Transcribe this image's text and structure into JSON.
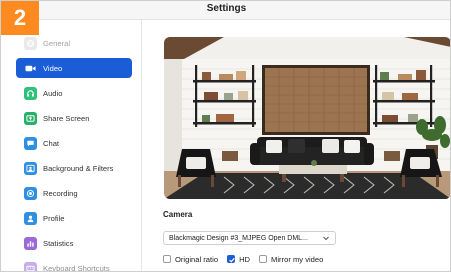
{
  "step_badge": "2",
  "window": {
    "title": "Settings"
  },
  "colors": {
    "accent": "#1a5dd6",
    "badge": "#ff8a1f"
  },
  "sidebar": {
    "items": [
      {
        "label": "General",
        "icon": "gear-icon",
        "color": "#b8b8b8",
        "active": false
      },
      {
        "label": "Video",
        "icon": "video-camera-icon",
        "color": "#ffffff",
        "active": true
      },
      {
        "label": "Audio",
        "icon": "headphones-icon",
        "color": "#2ec27a",
        "active": false
      },
      {
        "label": "Share Screen",
        "icon": "share-screen-icon",
        "color": "#26b06a",
        "active": false
      },
      {
        "label": "Chat",
        "icon": "chat-icon",
        "color": "#2f8fe0",
        "active": false
      },
      {
        "label": "Background & Filters",
        "icon": "person-background-icon",
        "color": "#2f8fe0",
        "active": false
      },
      {
        "label": "Recording",
        "icon": "record-icon",
        "color": "#2f8fe0",
        "active": false
      },
      {
        "label": "Profile",
        "icon": "profile-icon",
        "color": "#2f8fe0",
        "active": false
      },
      {
        "label": "Statistics",
        "icon": "statistics-icon",
        "color": "#9a6ad8",
        "active": false
      },
      {
        "label": "Keyboard Shortcuts",
        "icon": "keyboard-icon",
        "color": "#9a6ad8",
        "active": false
      }
    ]
  },
  "main": {
    "preview_alt": "Camera preview",
    "camera_label": "Camera",
    "camera_select": {
      "value": "Blackmagic Design #3_MJPEG Open DML..."
    },
    "options": [
      {
        "label": "Original ratio",
        "checked": false
      },
      {
        "label": "HD",
        "checked": true
      },
      {
        "label": "Mirror my video",
        "checked": false
      }
    ]
  }
}
